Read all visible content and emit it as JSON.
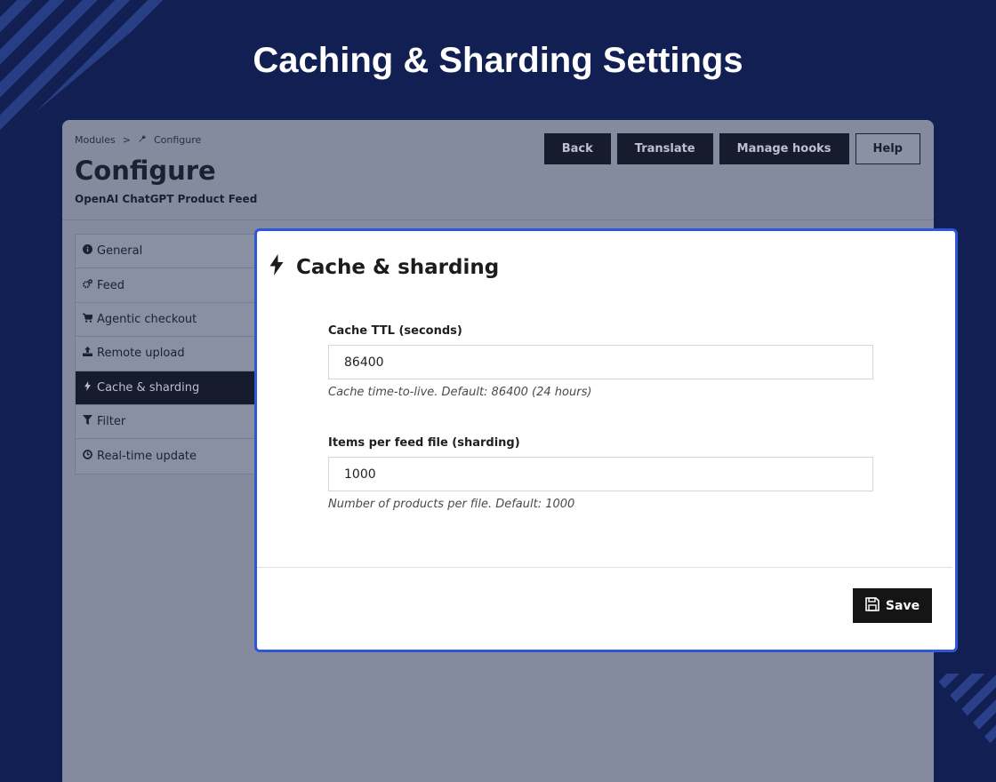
{
  "hero": {
    "title": "Caching & Sharding Settings"
  },
  "breadcrumb": {
    "parent": "Modules",
    "separator": ">",
    "current": "Configure"
  },
  "page": {
    "title": "Configure",
    "subtitle": "OpenAI ChatGPT Product Feed"
  },
  "toolbar": {
    "back": "Back",
    "translate": "Translate",
    "manage_hooks": "Manage hooks",
    "help": "Help"
  },
  "sidebar": {
    "items": [
      {
        "label": "General",
        "icon": "info-circle-icon"
      },
      {
        "label": "Feed",
        "icon": "cogs-icon"
      },
      {
        "label": "Agentic checkout",
        "icon": "cart-icon"
      },
      {
        "label": "Remote upload",
        "icon": "upload-icon"
      },
      {
        "label": "Cache & sharding",
        "icon": "bolt-icon",
        "active": true
      },
      {
        "label": "Filter",
        "icon": "filter-icon"
      },
      {
        "label": "Real-time update",
        "icon": "clock-icon"
      }
    ]
  },
  "panel": {
    "title": "Cache & sharding",
    "fields": [
      {
        "label": "Cache TTL (seconds)",
        "value": "86400",
        "help": "Cache time-to-live. Default: 86400 (24 hours)"
      },
      {
        "label": "Items per feed file (sharding)",
        "value": "1000",
        "help": "Number of products per file. Default: 1000"
      }
    ],
    "save_label": "Save"
  },
  "colors": {
    "background": "#111f52",
    "accent": "#2d56d8",
    "dark": "#161c2e"
  }
}
